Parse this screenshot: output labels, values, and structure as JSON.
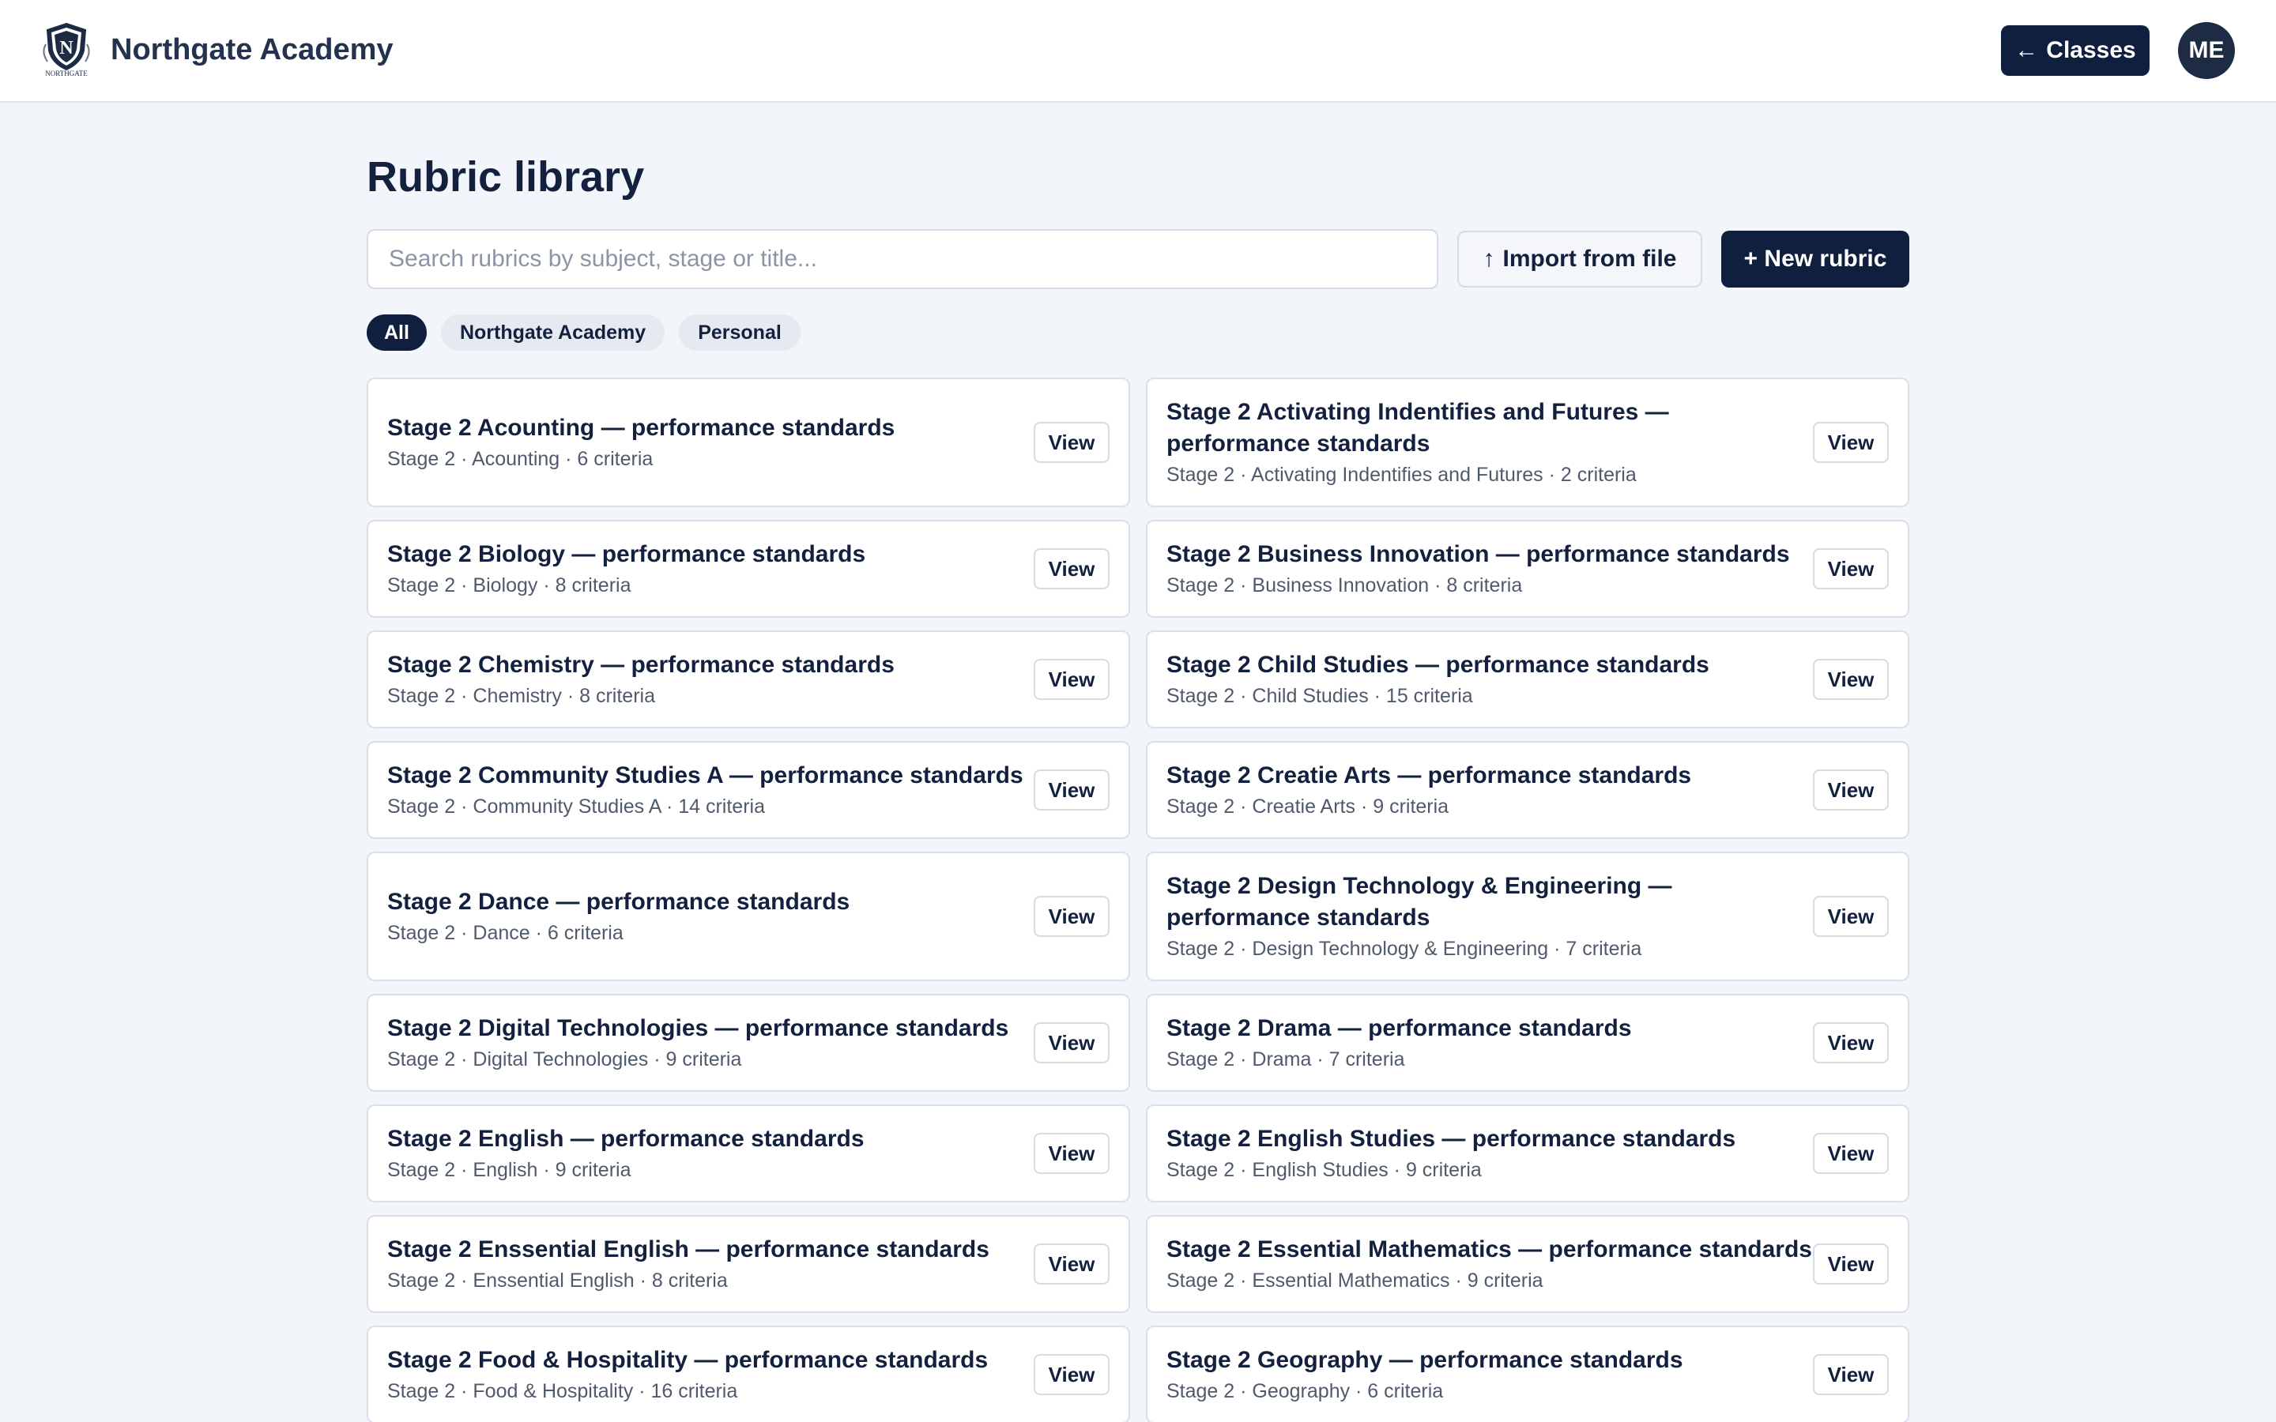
{
  "header": {
    "brand_name": "Northgate Academy",
    "logo_text": "NORTHGATE",
    "classes_label": "Classes",
    "avatar_initials": "ME"
  },
  "main": {
    "title": "Rubric library",
    "search_placeholder": "Search rubrics by subject, stage or title...",
    "import_label": "Import from file",
    "new_label": "+ New rubric",
    "filters": [
      "All",
      "Northgate Academy",
      "Personal"
    ],
    "active_filter": "All",
    "view_label": "View",
    "rubrics": [
      {
        "title": "Stage 2 Acounting — performance standards",
        "meta": "Stage 2 · Acounting · 6 criteria"
      },
      {
        "title": "Stage 2 Activating Indentifies and Futures — performance standards",
        "meta": "Stage 2 · Activating Indentifies and Futures · 2 criteria"
      },
      {
        "title": "Stage 2 Biology — performance standards",
        "meta": "Stage 2 · Biology · 8 criteria"
      },
      {
        "title": "Stage 2 Business Innovation — performance standards",
        "meta": "Stage 2 · Business Innovation · 8 criteria"
      },
      {
        "title": "Stage 2 Chemistry — performance standards",
        "meta": "Stage 2 · Chemistry · 8 criteria"
      },
      {
        "title": "Stage 2 Child Studies — performance standards",
        "meta": "Stage 2 · Child Studies · 15 criteria"
      },
      {
        "title": "Stage 2 Community Studies A — performance standards",
        "meta": "Stage 2 · Community Studies A · 14 criteria"
      },
      {
        "title": "Stage 2 Creatie Arts — performance standards",
        "meta": "Stage 2 · Creatie Arts · 9 criteria"
      },
      {
        "title": "Stage 2 Dance — performance standards",
        "meta": "Stage 2 · Dance · 6 criteria"
      },
      {
        "title": "Stage 2 Design Technology & Engineering — performance standards",
        "meta": "Stage 2 · Design Technology & Engineering · 7 criteria"
      },
      {
        "title": "Stage 2 Digital Technologies — performance standards",
        "meta": "Stage 2 · Digital Technologies · 9 criteria"
      },
      {
        "title": "Stage 2 Drama — performance standards",
        "meta": "Stage 2 · Drama · 7 criteria"
      },
      {
        "title": "Stage 2 English — performance standards",
        "meta": "Stage 2 · English · 9 criteria"
      },
      {
        "title": "Stage 2 English Studies — performance standards",
        "meta": "Stage 2 · English Studies · 9 criteria"
      },
      {
        "title": "Stage 2 Enssential English — performance standards",
        "meta": "Stage 2 · Enssential English · 8 criteria"
      },
      {
        "title": "Stage 2 Essential Mathematics — performance standards",
        "meta": "Stage 2 · Essential Mathematics · 9 criteria"
      },
      {
        "title": "Stage 2 Food & Hospitality — performance standards",
        "meta": "Stage 2 · Food & Hospitality · 16 criteria"
      },
      {
        "title": "Stage 2 Geography — performance standards",
        "meta": "Stage 2 · Geography · 6 criteria"
      }
    ]
  }
}
